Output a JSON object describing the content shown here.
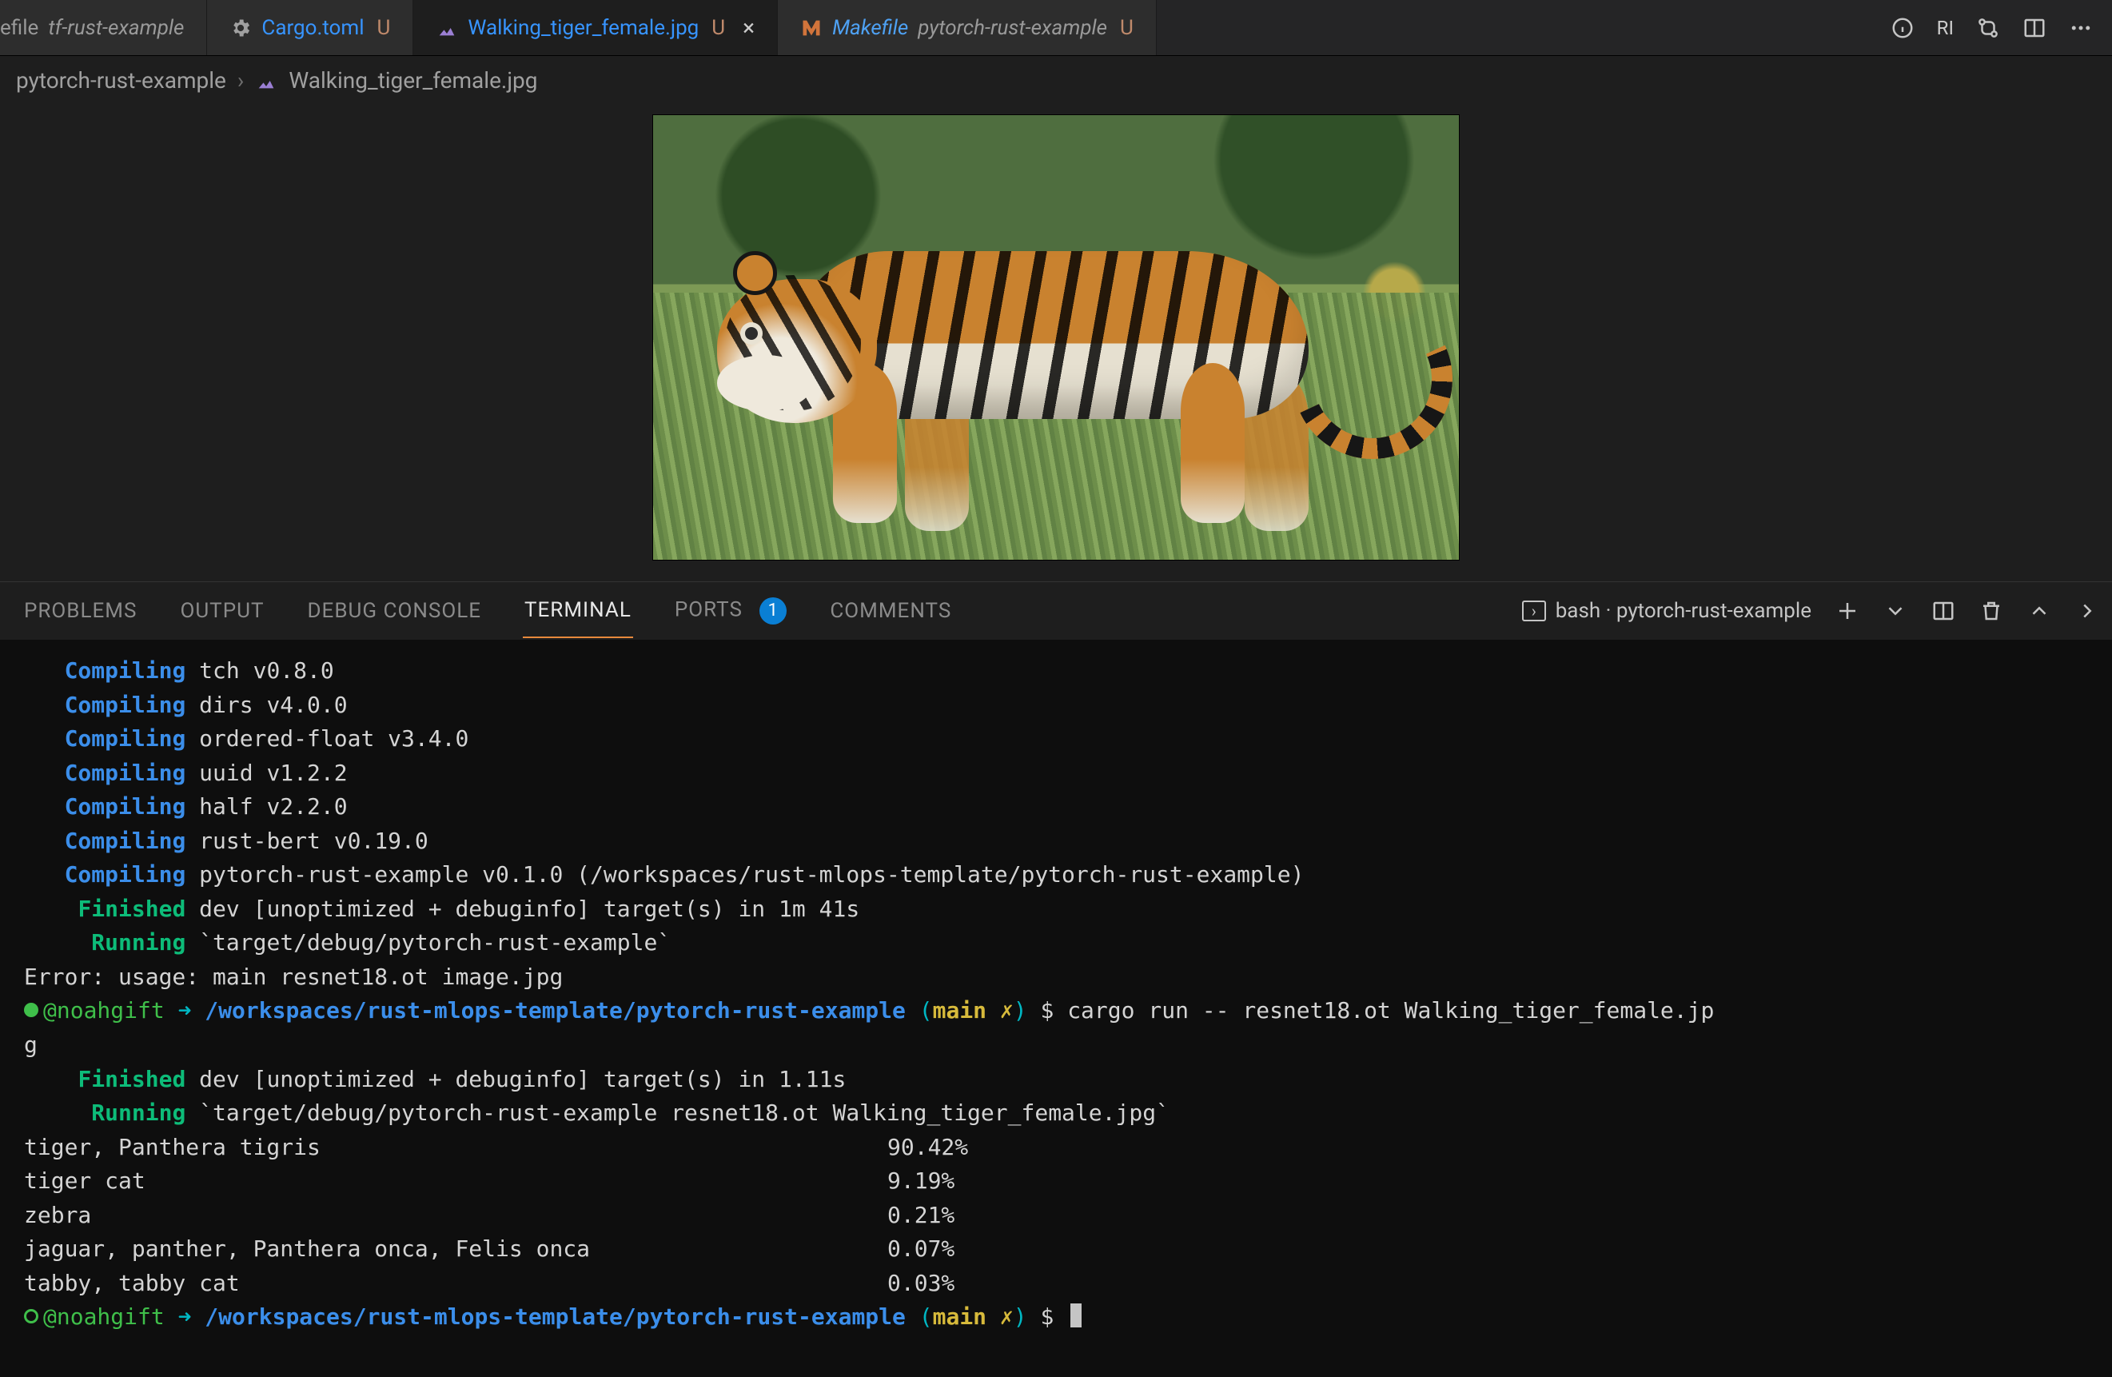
{
  "tabs": {
    "t0": {
      "prefix": "efile",
      "dim": "tf-rust-example"
    },
    "t1": {
      "name": "Cargo.toml",
      "mod": "U"
    },
    "t2": {
      "name": "Walking_tiger_female.jpg",
      "mod": "U"
    },
    "t3": {
      "name": "Makefile",
      "dim": "pytorch-rust-example",
      "mod": "U"
    }
  },
  "tab_actions": {
    "ri_label": "RI"
  },
  "breadcrumb": {
    "seg0": "pytorch-rust-example",
    "sep": "›",
    "seg1": "Walking_tiger_female.jpg"
  },
  "panel": {
    "tabs": {
      "problems": "PROBLEMS",
      "output": "OUTPUT",
      "debug": "DEBUG CONSOLE",
      "terminal": "TERMINAL",
      "ports": "PORTS",
      "ports_badge": "1",
      "comments": "COMMENTS"
    },
    "term_selector": "bash · pytorch-rust-example"
  },
  "terminal": {
    "compile": [
      {
        "k": "Compiling",
        "v": "tch v0.8.0"
      },
      {
        "k": "Compiling",
        "v": "dirs v4.0.0"
      },
      {
        "k": "Compiling",
        "v": "ordered-float v3.4.0"
      },
      {
        "k": "Compiling",
        "v": "uuid v1.2.2"
      },
      {
        "k": "Compiling",
        "v": "half v2.2.0"
      },
      {
        "k": "Compiling",
        "v": "rust-bert v0.19.0"
      },
      {
        "k": "Compiling",
        "v": "pytorch-rust-example v0.1.0 (/workspaces/rust-mlops-template/pytorch-rust-example)"
      }
    ],
    "finished1": {
      "k": "Finished",
      "v": "dev [unoptimized + debuginfo] target(s) in 1m 41s"
    },
    "running1": {
      "k": "Running",
      "v": "`target/debug/pytorch-rust-example`"
    },
    "error": "Error: usage: main resnet18.ot image.jpg",
    "prompt1": {
      "user": "@noahgift",
      "arrow": "➜",
      "path": "/workspaces/rust-mlops-template/pytorch-rust-example",
      "branch": "main",
      "dirty": "✗",
      "cmd": "cargo run -- resnet18.ot Walking_tiger_female.jpg",
      "wrap_tail": "g"
    },
    "finished2": {
      "k": "Finished",
      "v": "dev [unoptimized + debuginfo] target(s) in 1.11s"
    },
    "running2": {
      "k": "Running",
      "v": "`target/debug/pytorch-rust-example resnet18.ot Walking_tiger_female.jpg`"
    },
    "results": [
      {
        "label": "tiger, Panthera tigris",
        "pct": "90.42%"
      },
      {
        "label": "tiger cat",
        "pct": "9.19%"
      },
      {
        "label": "zebra",
        "pct": "0.21%"
      },
      {
        "label": "jaguar, panther, Panthera onca, Felis onca",
        "pct": "0.07%"
      },
      {
        "label": "tabby, tabby cat",
        "pct": "0.03%"
      }
    ],
    "prompt2": {
      "user": "@noahgift",
      "arrow": "➜",
      "path": "/workspaces/rust-mlops-template/pytorch-rust-example",
      "branch": "main",
      "dirty": "✗",
      "dollar": "$"
    }
  }
}
